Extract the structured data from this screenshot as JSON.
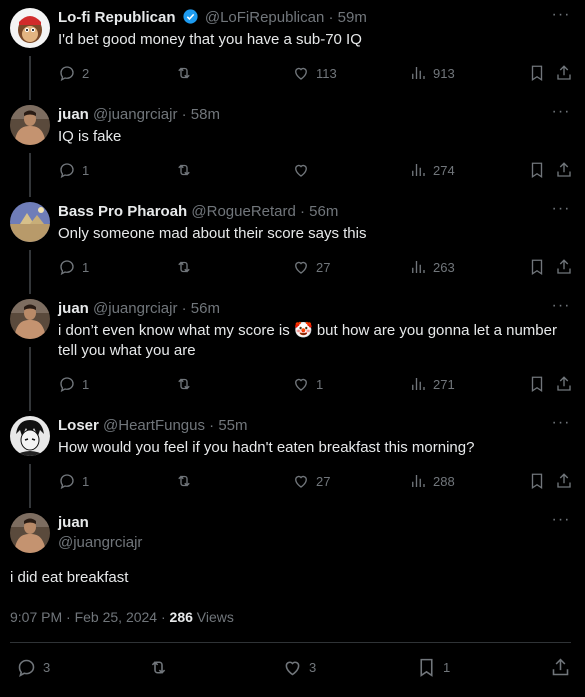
{
  "tweets": [
    {
      "name": "Lo-fi Republican",
      "handle": "@LoFiRepublican",
      "time": "· 59m",
      "text": "I'd bet good money that you have a sub-70 IQ",
      "replies": "2",
      "retweets": "",
      "likes": "113",
      "views": "913"
    },
    {
      "name": "juan",
      "handle": "@juangrciajr",
      "time": "· 58m",
      "text": "IQ is fake",
      "replies": "1",
      "retweets": "",
      "likes": "",
      "views": "274"
    },
    {
      "name": "Bass Pro Pharoah",
      "handle": "@RogueRetard",
      "time": "· 56m",
      "text": "Only someone mad about their score says this",
      "replies": "1",
      "retweets": "",
      "likes": "27",
      "views": "263"
    },
    {
      "name": "juan",
      "handle": "@juangrciajr",
      "time": "· 56m",
      "text_before": "i don’t even know what my score is",
      "emoji": "🤡",
      "text_after": "but how are you gonna let a number tell you what you are",
      "replies": "1",
      "retweets": "",
      "likes": "1",
      "views": "271"
    },
    {
      "name": "Loser",
      "handle": "@HeartFungus",
      "time": "· 55m",
      "text": "How would you feel if you hadn't eaten breakfast this morning?",
      "replies": "1",
      "retweets": "",
      "likes": "27",
      "views": "288"
    }
  ],
  "main": {
    "name": "juan",
    "handle": "@juangrciajr",
    "text": "i did eat breakfast",
    "timestamp": "9:07 PM · Feb 25, 2024 ·",
    "views_count": "286",
    "views_label": "Views",
    "replies": "3",
    "retweets": "",
    "likes": "3",
    "bookmarks": "1"
  },
  "colors": {
    "background": "#000000",
    "text": "#e7e9ea",
    "muted": "#71767b",
    "verified": "#1d9bf0"
  },
  "icons": [
    "reply-icon",
    "retweet-icon",
    "like-icon",
    "views-icon",
    "bookmark-icon",
    "share-icon",
    "more-icon",
    "verified-badge-icon"
  ]
}
